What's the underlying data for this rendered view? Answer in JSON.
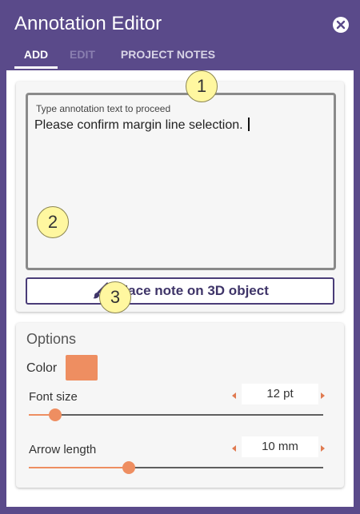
{
  "window": {
    "title": "Annotation Editor",
    "close_icon": "close-circle-icon"
  },
  "tabs": [
    {
      "label": "ADD",
      "state": "active"
    },
    {
      "label": "EDIT",
      "state": "disabled"
    },
    {
      "label": "PROJECT NOTES",
      "state": "inactive"
    }
  ],
  "annotation": {
    "label": "Type annotation text to proceed",
    "value": "Please confirm margin line selection."
  },
  "place_button": {
    "label": "Place note on 3D object",
    "icon": "paintbrush-icon"
  },
  "callouts": [
    "1",
    "2",
    "3"
  ],
  "options": {
    "title": "Options",
    "color_label": "Color",
    "color_value": "#ee8e61",
    "font_size": {
      "label": "Font size",
      "value": "12 pt",
      "slider_fraction": 0.09
    },
    "arrow_length": {
      "label": "Arrow length",
      "value": "10 mm",
      "slider_fraction": 0.34
    }
  },
  "colors": {
    "header": "#5a4a8a",
    "accent": "#ee8e61",
    "button_text": "#3e3468"
  }
}
